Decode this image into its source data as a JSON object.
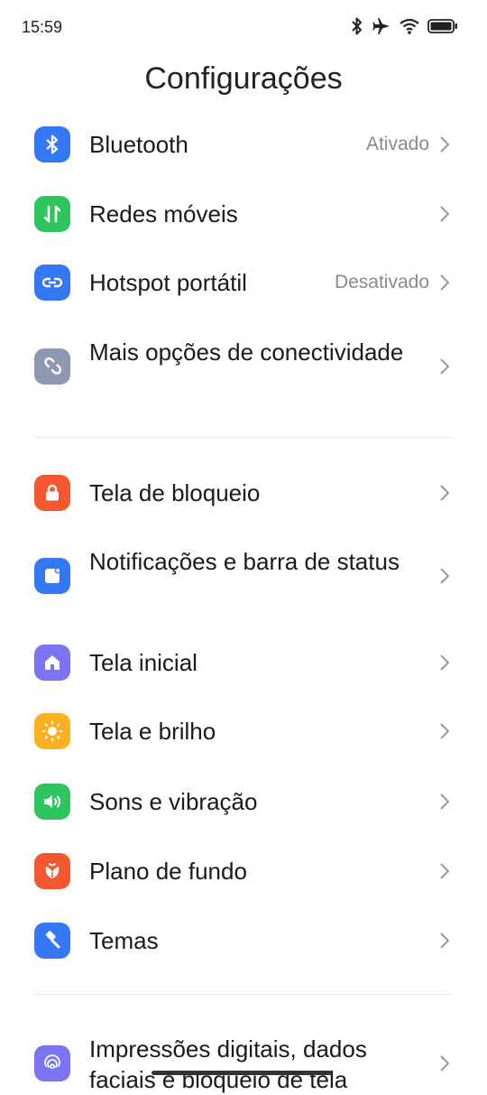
{
  "status_bar": {
    "time": "15:59"
  },
  "page": {
    "title": "Configurações"
  },
  "settings": [
    {
      "label": "Bluetooth",
      "value": "Ativado",
      "icon": "bluetooth-icon",
      "color": "#3478f6"
    },
    {
      "label": "Redes móveis",
      "value": "",
      "icon": "mobile-data-icon",
      "color": "#2fc55e"
    },
    {
      "label": "Hotspot portátil",
      "value": "Desativado",
      "icon": "hotspot-icon",
      "color": "#3478f6"
    },
    {
      "label": "Mais opções de conectividade",
      "value": "",
      "icon": "link-icon",
      "color": "#8e98b0"
    },
    {
      "label": "Tela de bloqueio",
      "value": "",
      "icon": "lock-icon",
      "color": "#f5582f"
    },
    {
      "label": "Notificações e barra de status",
      "value": "",
      "icon": "notification-icon",
      "color": "#3478f6"
    },
    {
      "label": "Tela inicial",
      "value": "",
      "icon": "home-icon",
      "color": "#7b74f0"
    },
    {
      "label": "Tela e brilho",
      "value": "",
      "icon": "brightness-icon",
      "color": "#fbb022"
    },
    {
      "label": "Sons e vibração",
      "value": "",
      "icon": "speaker-icon",
      "color": "#2fc55e"
    },
    {
      "label": "Plano de fundo",
      "value": "",
      "icon": "wallpaper-icon",
      "color": "#f5582f"
    },
    {
      "label": "Temas",
      "value": "",
      "icon": "themes-icon",
      "color": "#3478f6"
    },
    {
      "label": "Impressões digitais, dados faciais e bloqueio de tela",
      "value": "",
      "icon": "fingerprint-icon",
      "color": "#7b74f0"
    }
  ]
}
